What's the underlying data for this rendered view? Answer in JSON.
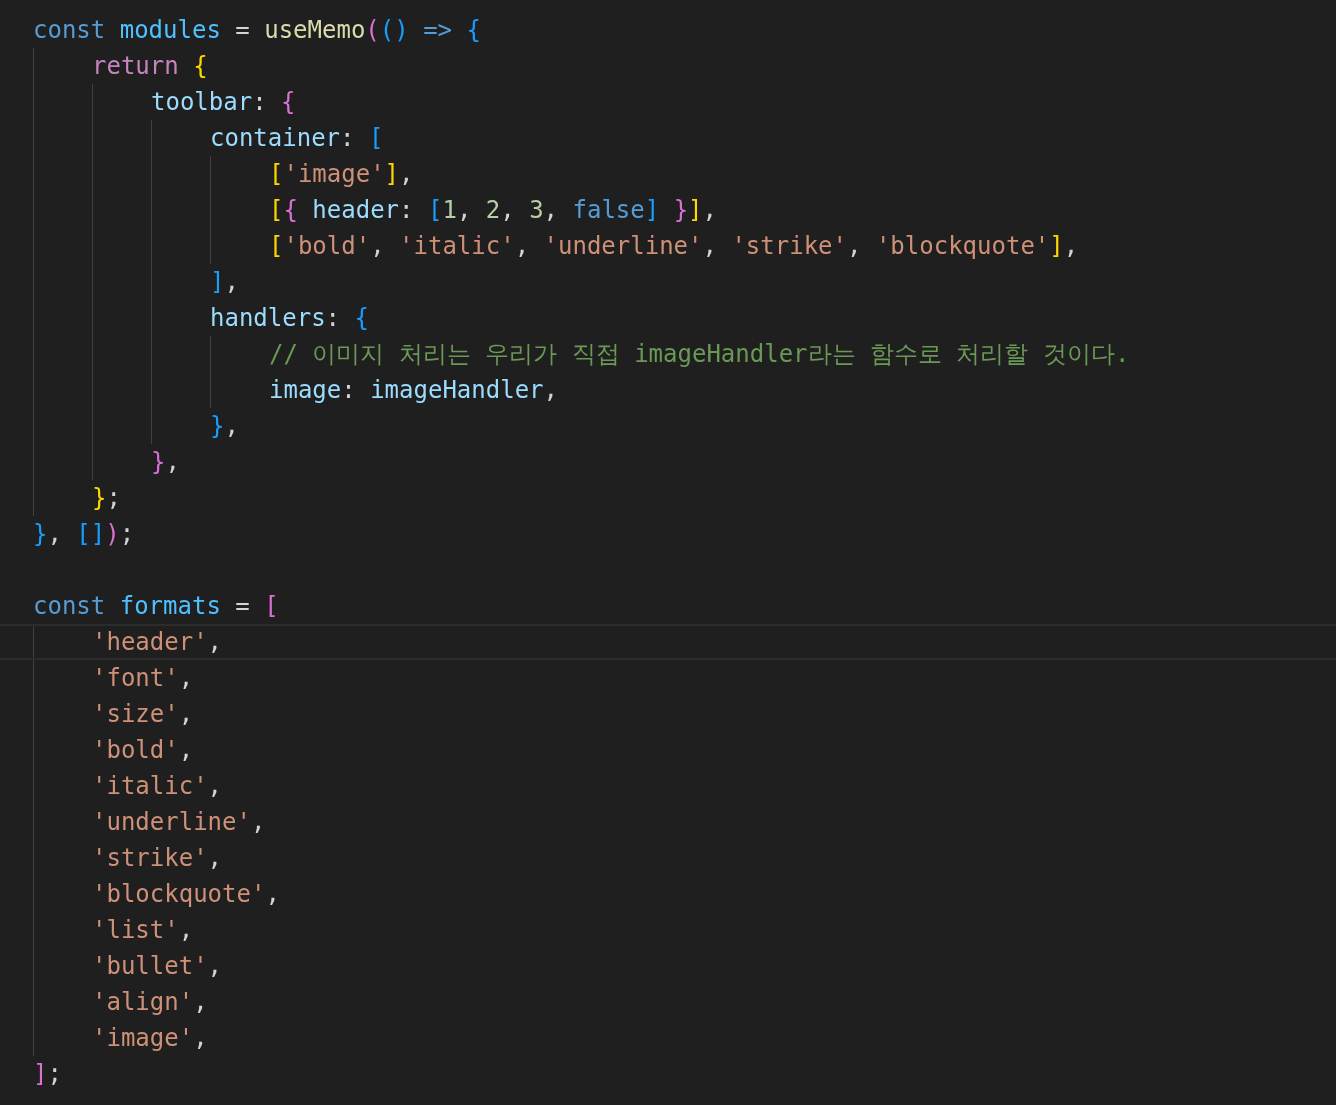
{
  "editor": {
    "lines": [
      {
        "kind": "code",
        "current": false,
        "tokens": [
          {
            "text": "const",
            "kind": "keyword"
          },
          {
            "text": " modules",
            "kind": "const"
          },
          {
            "text": " = ",
            "kind": "plain"
          },
          {
            "text": "useMemo",
            "kind": "function"
          },
          {
            "text": "(",
            "kind": "bracket2"
          },
          {
            "text": "()",
            "kind": "bracket3"
          },
          {
            "text": " => ",
            "kind": "keyword"
          },
          {
            "text": "{",
            "kind": "bracket3"
          }
        ],
        "children": [
          {
            "kind": "code",
            "current": false,
            "tokens": [
              {
                "text": "return",
                "kind": "control"
              },
              {
                "text": " {",
                "kind": "bracket1"
              }
            ],
            "children": [
              {
                "kind": "code",
                "current": false,
                "tokens": [
                  {
                    "text": "toolbar",
                    "kind": "property"
                  },
                  {
                    "text": ": ",
                    "kind": "plain"
                  },
                  {
                    "text": "{",
                    "kind": "bracket2"
                  }
                ],
                "children": [
                  {
                    "kind": "code",
                    "current": false,
                    "tokens": [
                      {
                        "text": "container",
                        "kind": "property"
                      },
                      {
                        "text": ": ",
                        "kind": "plain"
                      },
                      {
                        "text": "[",
                        "kind": "bracket3"
                      }
                    ],
                    "children": [
                      {
                        "kind": "code",
                        "current": false,
                        "tokens": [
                          {
                            "text": "[",
                            "kind": "bracket1"
                          },
                          {
                            "text": "'image'",
                            "kind": "string"
                          },
                          {
                            "text": "]",
                            "kind": "bracket1"
                          },
                          {
                            "text": ",",
                            "kind": "plain"
                          }
                        ]
                      },
                      {
                        "kind": "code",
                        "current": false,
                        "tokens": [
                          {
                            "text": "[",
                            "kind": "bracket1"
                          },
                          {
                            "text": "{",
                            "kind": "bracket2"
                          },
                          {
                            "text": " header",
                            "kind": "property"
                          },
                          {
                            "text": ": ",
                            "kind": "plain"
                          },
                          {
                            "text": "[",
                            "kind": "bracket3"
                          },
                          {
                            "text": "1",
                            "kind": "number"
                          },
                          {
                            "text": ", ",
                            "kind": "plain"
                          },
                          {
                            "text": "2",
                            "kind": "number"
                          },
                          {
                            "text": ", ",
                            "kind": "plain"
                          },
                          {
                            "text": "3",
                            "kind": "number"
                          },
                          {
                            "text": ", ",
                            "kind": "plain"
                          },
                          {
                            "text": "false",
                            "kind": "keyword"
                          },
                          {
                            "text": "]",
                            "kind": "bracket3"
                          },
                          {
                            "text": " }",
                            "kind": "bracket2"
                          },
                          {
                            "text": "]",
                            "kind": "bracket1"
                          },
                          {
                            "text": ",",
                            "kind": "plain"
                          }
                        ]
                      },
                      {
                        "kind": "code",
                        "current": false,
                        "tokens": [
                          {
                            "text": "[",
                            "kind": "bracket1"
                          },
                          {
                            "text": "'bold'",
                            "kind": "string"
                          },
                          {
                            "text": ", ",
                            "kind": "plain"
                          },
                          {
                            "text": "'italic'",
                            "kind": "string"
                          },
                          {
                            "text": ", ",
                            "kind": "plain"
                          },
                          {
                            "text": "'underline'",
                            "kind": "string"
                          },
                          {
                            "text": ", ",
                            "kind": "plain"
                          },
                          {
                            "text": "'strike'",
                            "kind": "string"
                          },
                          {
                            "text": ", ",
                            "kind": "plain"
                          },
                          {
                            "text": "'blockquote'",
                            "kind": "string"
                          },
                          {
                            "text": "]",
                            "kind": "bracket1"
                          },
                          {
                            "text": ",",
                            "kind": "plain"
                          }
                        ]
                      }
                    ]
                  },
                  {
                    "kind": "code",
                    "current": false,
                    "tokens": [
                      {
                        "text": "]",
                        "kind": "bracket3"
                      },
                      {
                        "text": ",",
                        "kind": "plain"
                      }
                    ]
                  },
                  {
                    "kind": "code",
                    "current": false,
                    "tokens": [
                      {
                        "text": "handlers",
                        "kind": "property"
                      },
                      {
                        "text": ": ",
                        "kind": "plain"
                      },
                      {
                        "text": "{",
                        "kind": "bracket3"
                      }
                    ],
                    "children": [
                      {
                        "kind": "code",
                        "current": false,
                        "tokens": [
                          {
                            "text": "// 이미지 처리는 우리가 직접 imageHandler라는 함수로 처리할 것이다.",
                            "kind": "comment"
                          }
                        ]
                      },
                      {
                        "kind": "code",
                        "current": false,
                        "tokens": [
                          {
                            "text": "image",
                            "kind": "property"
                          },
                          {
                            "text": ": ",
                            "kind": "plain"
                          },
                          {
                            "text": "imageHandler",
                            "kind": "variable"
                          },
                          {
                            "text": ",",
                            "kind": "plain"
                          }
                        ]
                      }
                    ]
                  },
                  {
                    "kind": "code",
                    "current": false,
                    "tokens": [
                      {
                        "text": "}",
                        "kind": "bracket3"
                      },
                      {
                        "text": ",",
                        "kind": "plain"
                      }
                    ]
                  }
                ]
              },
              {
                "kind": "code",
                "current": false,
                "tokens": [
                  {
                    "text": "}",
                    "kind": "bracket2"
                  },
                  {
                    "text": ",",
                    "kind": "plain"
                  }
                ]
              }
            ]
          },
          {
            "kind": "code",
            "current": false,
            "tokens": [
              {
                "text": "}",
                "kind": "bracket1"
              },
              {
                "text": ";",
                "kind": "plain"
              }
            ]
          }
        ]
      },
      {
        "kind": "code",
        "current": false,
        "tokens": [
          {
            "text": "}",
            "kind": "bracket3"
          },
          {
            "text": ", ",
            "kind": "plain"
          },
          {
            "text": "[]",
            "kind": "bracket3"
          },
          {
            "text": ")",
            "kind": "bracket2"
          },
          {
            "text": ";",
            "kind": "plain"
          }
        ]
      },
      {
        "kind": "blank",
        "current": false
      },
      {
        "kind": "code",
        "current": false,
        "tokens": [
          {
            "text": "const",
            "kind": "keyword"
          },
          {
            "text": " formats",
            "kind": "const"
          },
          {
            "text": " = ",
            "kind": "plain"
          },
          {
            "text": "[",
            "kind": "bracket2"
          }
        ],
        "children": [
          {
            "kind": "code",
            "current": true,
            "tokens": [
              {
                "text": "'header'",
                "kind": "string"
              },
              {
                "text": ",",
                "kind": "plain"
              }
            ]
          },
          {
            "kind": "code",
            "current": false,
            "tokens": [
              {
                "text": "'font'",
                "kind": "string"
              },
              {
                "text": ",",
                "kind": "plain"
              }
            ]
          },
          {
            "kind": "code",
            "current": false,
            "tokens": [
              {
                "text": "'size'",
                "kind": "string"
              },
              {
                "text": ",",
                "kind": "plain"
              }
            ]
          },
          {
            "kind": "code",
            "current": false,
            "tokens": [
              {
                "text": "'bold'",
                "kind": "string"
              },
              {
                "text": ",",
                "kind": "plain"
              }
            ]
          },
          {
            "kind": "code",
            "current": false,
            "tokens": [
              {
                "text": "'italic'",
                "kind": "string"
              },
              {
                "text": ",",
                "kind": "plain"
              }
            ]
          },
          {
            "kind": "code",
            "current": false,
            "tokens": [
              {
                "text": "'underline'",
                "kind": "string"
              },
              {
                "text": ",",
                "kind": "plain"
              }
            ]
          },
          {
            "kind": "code",
            "current": false,
            "tokens": [
              {
                "text": "'strike'",
                "kind": "string"
              },
              {
                "text": ",",
                "kind": "plain"
              }
            ]
          },
          {
            "kind": "code",
            "current": false,
            "tokens": [
              {
                "text": "'blockquote'",
                "kind": "string"
              },
              {
                "text": ",",
                "kind": "plain"
              }
            ]
          },
          {
            "kind": "code",
            "current": false,
            "tokens": [
              {
                "text": "'list'",
                "kind": "string"
              },
              {
                "text": ",",
                "kind": "plain"
              }
            ]
          },
          {
            "kind": "code",
            "current": false,
            "tokens": [
              {
                "text": "'bullet'",
                "kind": "string"
              },
              {
                "text": ",",
                "kind": "plain"
              }
            ]
          },
          {
            "kind": "code",
            "current": false,
            "tokens": [
              {
                "text": "'align'",
                "kind": "string"
              },
              {
                "text": ",",
                "kind": "plain"
              }
            ]
          },
          {
            "kind": "code",
            "current": false,
            "tokens": [
              {
                "text": "'image'",
                "kind": "string"
              },
              {
                "text": ",",
                "kind": "plain"
              }
            ]
          }
        ]
      },
      {
        "kind": "code",
        "current": false,
        "tokens": [
          {
            "text": "]",
            "kind": "bracket2"
          },
          {
            "text": ";",
            "kind": "plain"
          }
        ]
      }
    ]
  }
}
